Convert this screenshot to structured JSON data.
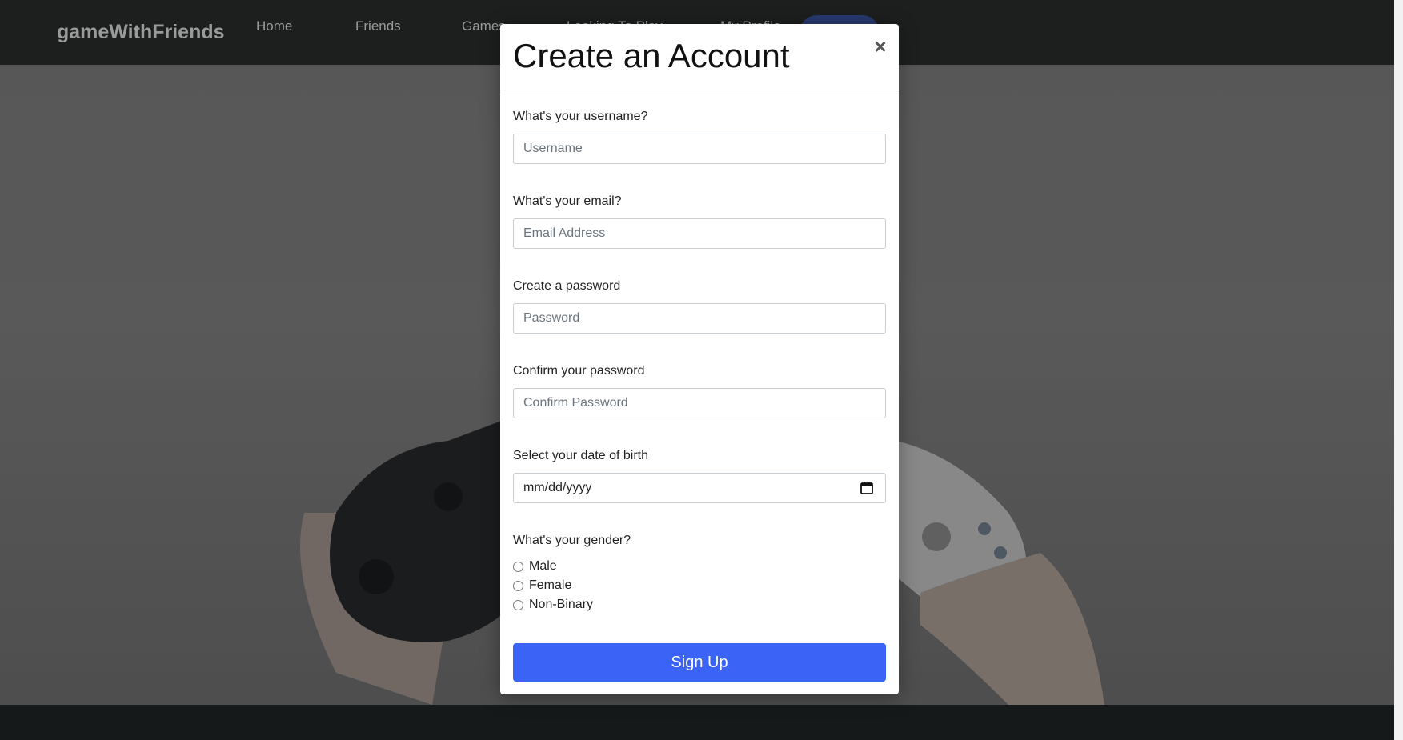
{
  "navbar": {
    "brand": "gameWithFriends",
    "links": [
      "Home",
      "Friends",
      "Games",
      "Looking To Play",
      "My Profile"
    ]
  },
  "modal": {
    "title": "Create an Account",
    "close_symbol": "×",
    "username": {
      "label": "What's your username?",
      "placeholder": "Username"
    },
    "email": {
      "label": "What's your email?",
      "placeholder": "Email Address"
    },
    "password": {
      "label": "Create a password",
      "placeholder": "Password"
    },
    "confirm": {
      "label": "Confirm your password",
      "placeholder": "Confirm Password"
    },
    "dob": {
      "label": "Select your date of birth",
      "value": "mm/dd/yyyy",
      "icon": "calendar-icon"
    },
    "gender": {
      "label": "What's your gender?",
      "options": [
        "Male",
        "Female",
        "Non-Binary"
      ]
    },
    "submit_label": "Sign Up"
  },
  "colors": {
    "navbar_bg": "#1d1f1f",
    "primary_button": "#3b63f5",
    "footer_bg": "#15191a"
  }
}
